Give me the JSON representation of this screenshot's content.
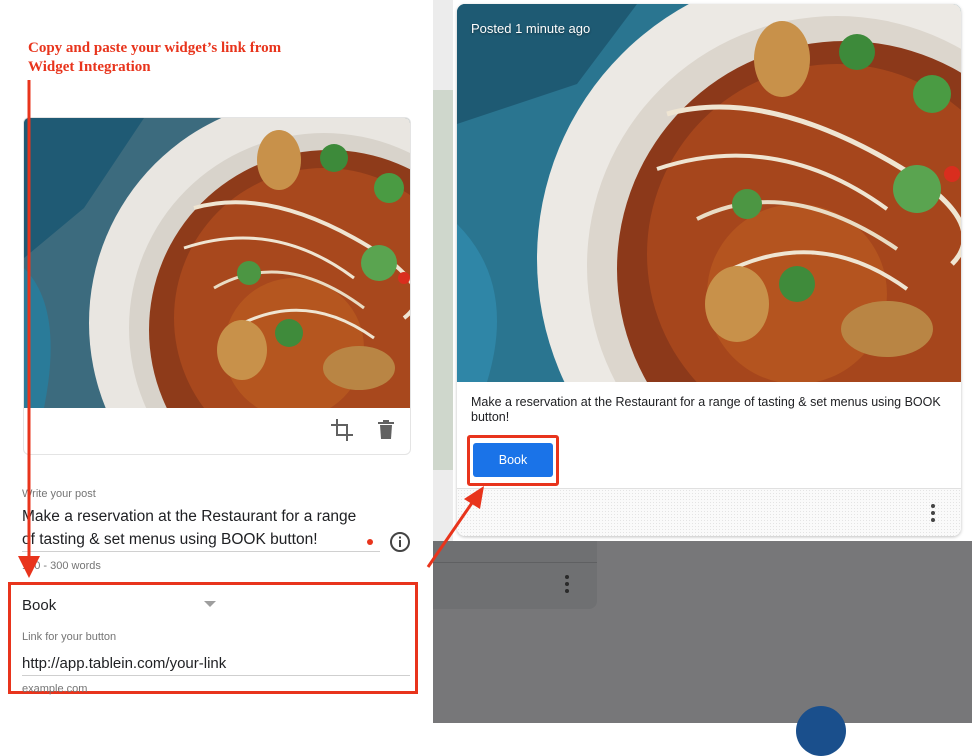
{
  "annotation": {
    "line1": "Copy and paste your widget’s link from",
    "line2": "Widget Integration"
  },
  "editor": {
    "post_label": "Write your post",
    "post_text": "Make a reservation at the Restaurant for a range of tasting & set menus using BOOK button!",
    "word_hint": "100 - 300 words",
    "button_type": "Book",
    "link_label": "Link for your button",
    "link_value": "http://app.tablein.com/your-link",
    "link_hint": "example.com",
    "icons": [
      "crop-icon",
      "trash-icon",
      "info-icon",
      "chevron-down-icon"
    ]
  },
  "preview": {
    "posted_time": "Posted 1 minute ago",
    "text": "Make a reservation at the Restaurant for a range of tasting & set menus using BOOK button!",
    "button_label": "Book",
    "icons": [
      "more-vert-icon"
    ]
  },
  "colors": {
    "annotation_red": "#e8341c",
    "button_blue": "#1a73e8",
    "overlay_gray": "#777779"
  }
}
